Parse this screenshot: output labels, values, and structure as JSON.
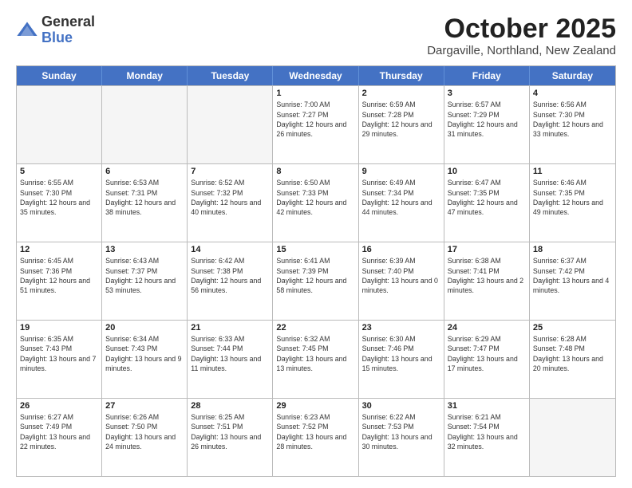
{
  "logo": {
    "general": "General",
    "blue": "Blue"
  },
  "title": "October 2025",
  "location": "Dargaville, Northland, New Zealand",
  "days_of_week": [
    "Sunday",
    "Monday",
    "Tuesday",
    "Wednesday",
    "Thursday",
    "Friday",
    "Saturday"
  ],
  "weeks": [
    [
      {
        "day": "",
        "info": ""
      },
      {
        "day": "",
        "info": ""
      },
      {
        "day": "",
        "info": ""
      },
      {
        "day": "1",
        "info": "Sunrise: 7:00 AM\nSunset: 7:27 PM\nDaylight: 12 hours and 26 minutes."
      },
      {
        "day": "2",
        "info": "Sunrise: 6:59 AM\nSunset: 7:28 PM\nDaylight: 12 hours and 29 minutes."
      },
      {
        "day": "3",
        "info": "Sunrise: 6:57 AM\nSunset: 7:29 PM\nDaylight: 12 hours and 31 minutes."
      },
      {
        "day": "4",
        "info": "Sunrise: 6:56 AM\nSunset: 7:30 PM\nDaylight: 12 hours and 33 minutes."
      }
    ],
    [
      {
        "day": "5",
        "info": "Sunrise: 6:55 AM\nSunset: 7:30 PM\nDaylight: 12 hours and 35 minutes."
      },
      {
        "day": "6",
        "info": "Sunrise: 6:53 AM\nSunset: 7:31 PM\nDaylight: 12 hours and 38 minutes."
      },
      {
        "day": "7",
        "info": "Sunrise: 6:52 AM\nSunset: 7:32 PM\nDaylight: 12 hours and 40 minutes."
      },
      {
        "day": "8",
        "info": "Sunrise: 6:50 AM\nSunset: 7:33 PM\nDaylight: 12 hours and 42 minutes."
      },
      {
        "day": "9",
        "info": "Sunrise: 6:49 AM\nSunset: 7:34 PM\nDaylight: 12 hours and 44 minutes."
      },
      {
        "day": "10",
        "info": "Sunrise: 6:47 AM\nSunset: 7:35 PM\nDaylight: 12 hours and 47 minutes."
      },
      {
        "day": "11",
        "info": "Sunrise: 6:46 AM\nSunset: 7:35 PM\nDaylight: 12 hours and 49 minutes."
      }
    ],
    [
      {
        "day": "12",
        "info": "Sunrise: 6:45 AM\nSunset: 7:36 PM\nDaylight: 12 hours and 51 minutes."
      },
      {
        "day": "13",
        "info": "Sunrise: 6:43 AM\nSunset: 7:37 PM\nDaylight: 12 hours and 53 minutes."
      },
      {
        "day": "14",
        "info": "Sunrise: 6:42 AM\nSunset: 7:38 PM\nDaylight: 12 hours and 56 minutes."
      },
      {
        "day": "15",
        "info": "Sunrise: 6:41 AM\nSunset: 7:39 PM\nDaylight: 12 hours and 58 minutes."
      },
      {
        "day": "16",
        "info": "Sunrise: 6:39 AM\nSunset: 7:40 PM\nDaylight: 13 hours and 0 minutes."
      },
      {
        "day": "17",
        "info": "Sunrise: 6:38 AM\nSunset: 7:41 PM\nDaylight: 13 hours and 2 minutes."
      },
      {
        "day": "18",
        "info": "Sunrise: 6:37 AM\nSunset: 7:42 PM\nDaylight: 13 hours and 4 minutes."
      }
    ],
    [
      {
        "day": "19",
        "info": "Sunrise: 6:35 AM\nSunset: 7:43 PM\nDaylight: 13 hours and 7 minutes."
      },
      {
        "day": "20",
        "info": "Sunrise: 6:34 AM\nSunset: 7:43 PM\nDaylight: 13 hours and 9 minutes."
      },
      {
        "day": "21",
        "info": "Sunrise: 6:33 AM\nSunset: 7:44 PM\nDaylight: 13 hours and 11 minutes."
      },
      {
        "day": "22",
        "info": "Sunrise: 6:32 AM\nSunset: 7:45 PM\nDaylight: 13 hours and 13 minutes."
      },
      {
        "day": "23",
        "info": "Sunrise: 6:30 AM\nSunset: 7:46 PM\nDaylight: 13 hours and 15 minutes."
      },
      {
        "day": "24",
        "info": "Sunrise: 6:29 AM\nSunset: 7:47 PM\nDaylight: 13 hours and 17 minutes."
      },
      {
        "day": "25",
        "info": "Sunrise: 6:28 AM\nSunset: 7:48 PM\nDaylight: 13 hours and 20 minutes."
      }
    ],
    [
      {
        "day": "26",
        "info": "Sunrise: 6:27 AM\nSunset: 7:49 PM\nDaylight: 13 hours and 22 minutes."
      },
      {
        "day": "27",
        "info": "Sunrise: 6:26 AM\nSunset: 7:50 PM\nDaylight: 13 hours and 24 minutes."
      },
      {
        "day": "28",
        "info": "Sunrise: 6:25 AM\nSunset: 7:51 PM\nDaylight: 13 hours and 26 minutes."
      },
      {
        "day": "29",
        "info": "Sunrise: 6:23 AM\nSunset: 7:52 PM\nDaylight: 13 hours and 28 minutes."
      },
      {
        "day": "30",
        "info": "Sunrise: 6:22 AM\nSunset: 7:53 PM\nDaylight: 13 hours and 30 minutes."
      },
      {
        "day": "31",
        "info": "Sunrise: 6:21 AM\nSunset: 7:54 PM\nDaylight: 13 hours and 32 minutes."
      },
      {
        "day": "",
        "info": ""
      }
    ]
  ]
}
